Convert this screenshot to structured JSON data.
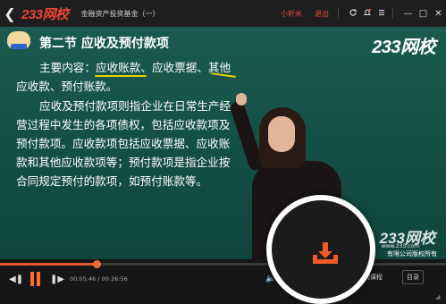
{
  "titlebar": {
    "back_glyph": "❮",
    "logo": "233网校",
    "course_title": "金融资产投资基金（一）",
    "user": "小轩米",
    "logout": "退出",
    "icons": [
      "refresh-icon",
      "bell-icon",
      "menu-icon"
    ],
    "window_buttons": [
      "—",
      "□",
      "✕"
    ]
  },
  "video": {
    "section_title": "第二节    应收及预付款项",
    "watermark": "233网校",
    "paragraph1": [
      "主要内容：应收账款、应收票据、其他",
      "应收款、预付账款。"
    ],
    "paragraph2": [
      "应收及预付款项则指企业在日常生产经",
      "营过程中发生的各项债权，包括应收款项及",
      "预付款项。应收款项包括应收票据、应收账",
      "款和其他应收款项等；预付款项是指企业按",
      "合同规定预付的款项，如预付账款等。"
    ],
    "bottom_watermark": "233网校",
    "bottom_url": "www.233.com",
    "bottom_copyright": "有限公司版权所有"
  },
  "controls": {
    "progress_fraction": 0.216,
    "time_label": "00:05:46 / 00:26:56",
    "course_button": "的课程",
    "menu_button": "目录"
  },
  "colors": {
    "accent": "#e8542e",
    "board": "#114c43",
    "underline": "#e6d400"
  },
  "overlay": {
    "icon": "download-icon"
  }
}
